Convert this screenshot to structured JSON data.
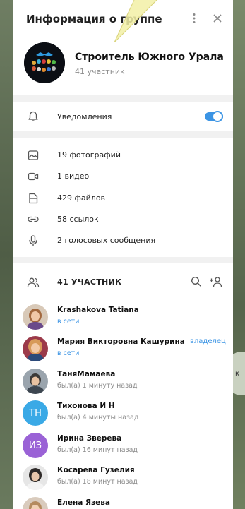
{
  "panel": {
    "title": "Информация о группе",
    "group_name": "Строитель Южного Урала",
    "group_members_count": "41 участник"
  },
  "notifications": {
    "label": "Уведомления",
    "enabled": true
  },
  "media": [
    {
      "icon": "photo-icon",
      "label": "19 фотографий"
    },
    {
      "icon": "video-icon",
      "label": "1 видео"
    },
    {
      "icon": "file-icon",
      "label": "429 файлов"
    },
    {
      "icon": "link-icon",
      "label": "58 ссылок"
    },
    {
      "icon": "microphone-icon",
      "label": "2 голосовых сообщения"
    }
  ],
  "members": {
    "title": "41 УЧАСТНИК",
    "list": [
      {
        "name": "Krashakova Tatiana",
        "status": "в сети",
        "online": true,
        "role": "",
        "initials": "",
        "avatar_color": "#b98a6e"
      },
      {
        "name": "Мария Викторовна Кашурина",
        "status": "в сети",
        "online": true,
        "role": "владелец",
        "initials": "",
        "avatar_color": "#c67b55"
      },
      {
        "name": "ТаняМамаева",
        "status": "был(а) 1 минуту назад",
        "online": false,
        "role": "",
        "initials": "",
        "avatar_color": "#6f7b86"
      },
      {
        "name": "Тихонова И Н",
        "status": "был(а) 4 минуты назад",
        "online": false,
        "role": "",
        "initials": "ТН",
        "avatar_color": "#3aa9e6"
      },
      {
        "name": "Ирина Зверева",
        "status": "был(а) 16 минут назад",
        "online": false,
        "role": "",
        "initials": "ИЗ",
        "avatar_color": "#9a62d6"
      },
      {
        "name": "Косарева Гузелия",
        "status": "был(а) 18 минут назад",
        "online": false,
        "role": "",
        "initials": "",
        "avatar_color": "#5b5f66"
      },
      {
        "name": "Елена Язева",
        "status": "",
        "online": false,
        "role": "",
        "initials": "",
        "avatar_color": "#c9a58a"
      }
    ]
  },
  "colors": {
    "accent": "#3b94e4",
    "panel_bg": "#f1f1f1",
    "card_bg": "#ffffff",
    "muted": "#8c8c8c"
  }
}
